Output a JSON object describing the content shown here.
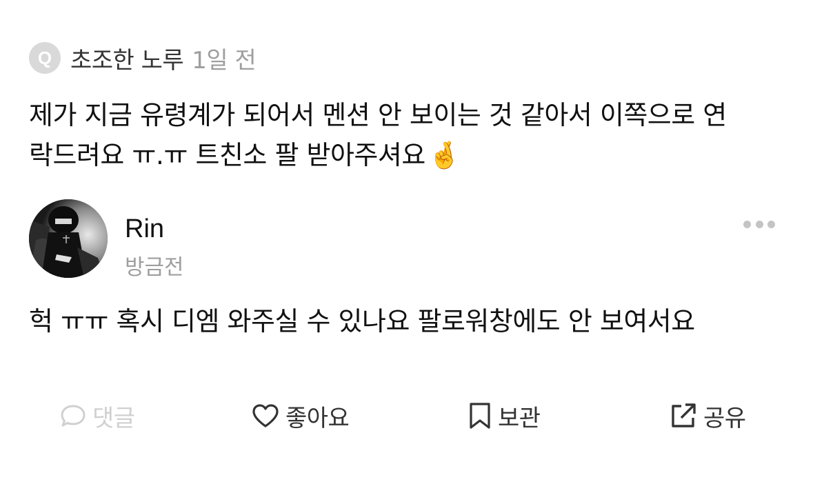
{
  "question": {
    "badge": "Q",
    "author": "초조한 노루",
    "time": "1일 전",
    "body_line1": "제가 지금 유령계가 되어서 멘션 안 보이는 것 같아서 이쪽으로 연",
    "body_line2": "락드려요 ㅠ.ㅠ 트친소 팔 받아주셔요",
    "emoji": "🤞"
  },
  "answer": {
    "name": "Rin",
    "time": "방금전",
    "body": "헉 ㅠㅠ 혹시 디엠 와주실 수 있나요 팔로워창에도 안 보여서요"
  },
  "actions": {
    "comment": {
      "label": "댓글",
      "icon": "speech-bubble-icon",
      "state": "disabled"
    },
    "like": {
      "label": "좋아요",
      "icon": "heart-icon",
      "state": "enabled"
    },
    "save": {
      "label": "보관",
      "icon": "bookmark-icon",
      "state": "enabled"
    },
    "share": {
      "label": "공유",
      "icon": "share-icon",
      "state": "enabled"
    }
  },
  "colors": {
    "text_primary": "#111111",
    "text_secondary": "#9e9e9e",
    "badge_bg": "#d9d9d9",
    "disabled": "#d0d0d0",
    "action_text": "#333333"
  }
}
